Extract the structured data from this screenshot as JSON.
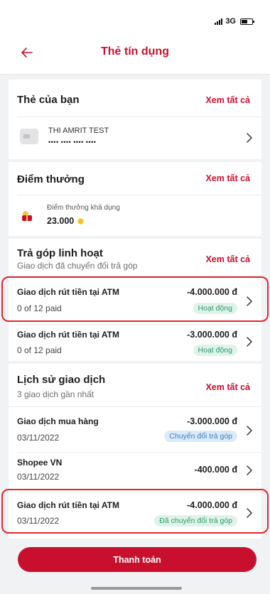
{
  "status_bar": {
    "network": "3G"
  },
  "header": {
    "title": "Thẻ tín dụng"
  },
  "cards_section": {
    "title": "Thẻ của bạn",
    "see_all": "Xem tất cả",
    "card": {
      "holder": "THI AMRIT TEST",
      "number": "•••• •••• •••• ••••"
    }
  },
  "points_section": {
    "title": "Điểm thưởng",
    "see_all": "Xem tất cả",
    "label": "Điểm thưởng khả dụng",
    "value": "23.000"
  },
  "installment_section": {
    "title": "Trả góp linh hoạt",
    "subtitle": "Giao dịch đã chuyển đổi trả góp",
    "see_all": "Xem tất cả",
    "items": [
      {
        "name": "Giao dịch rút tiền tại ATM",
        "progress": "0 of 12 paid",
        "amount": "-4.000.000 đ",
        "status": "Hoạt động"
      },
      {
        "name": "Giao dịch rút tiền tại ATM",
        "progress": "0 of 12 paid",
        "amount": "-3.000.000 đ",
        "status": "Hoạt động"
      }
    ]
  },
  "history_section": {
    "title": "Lịch sử giao dịch",
    "subtitle": "3 giao dịch gần nhất",
    "see_all": "Xem tất cả",
    "items": [
      {
        "name": "Giao dịch mua hàng",
        "date": "03/11/2022",
        "amount": "-3.000.000 đ",
        "status": "Chuyển đổi trả góp"
      },
      {
        "name": "Shopee VN",
        "date": "03/11/2022",
        "amount": "-400.000 đ"
      },
      {
        "name": "Giao dịch rút tiền tại ATM",
        "date": "03/11/2022",
        "amount": "-4.000.000 đ",
        "status": "Đã chuyển đổi trả góp"
      }
    ]
  },
  "footer": {
    "pay_button": "Thanh toán"
  },
  "colors": {
    "accent": "#c8102e",
    "badge_green": "#2b9a6b",
    "badge_blue": "#3b7ec4",
    "highlight": "#e4262c"
  }
}
